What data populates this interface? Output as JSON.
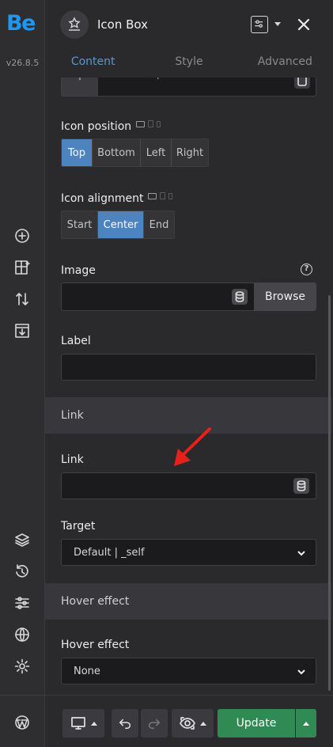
{
  "app": {
    "logo": "Be",
    "version": "v26.8.5"
  },
  "header": {
    "title": "Icon Box",
    "widget_icon": "star-badge-icon"
  },
  "tabs": [
    {
      "label": "Content",
      "active": true
    },
    {
      "label": "Style",
      "active": false
    },
    {
      "label": "Advanced",
      "active": false
    }
  ],
  "fields": {
    "icon": {
      "value": "icon-lamp"
    },
    "icon_position": {
      "label": "Icon position",
      "options": [
        "Top",
        "Bottom",
        "Left",
        "Right"
      ],
      "selected": "Top"
    },
    "icon_alignment": {
      "label": "Icon alignment",
      "options": [
        "Start",
        "Center",
        "End"
      ],
      "selected": "Center"
    },
    "image": {
      "label": "Image",
      "value": "",
      "browse_label": "Browse",
      "help_glyph": "?"
    },
    "label": {
      "label": "Label",
      "value": ""
    },
    "link_section": {
      "title": "Link"
    },
    "link": {
      "label": "Link",
      "value": ""
    },
    "target": {
      "label": "Target",
      "value": "Default | _self"
    },
    "hover_section": {
      "title": "Hover effect"
    },
    "hover_effect": {
      "label": "Hover effect",
      "value": "None"
    }
  },
  "footer": {
    "update_label": "Update"
  },
  "colors": {
    "accent": "#4d84c0",
    "brand": "#1d97f2",
    "update": "#2f8a54",
    "annotation": "#e8201a"
  }
}
